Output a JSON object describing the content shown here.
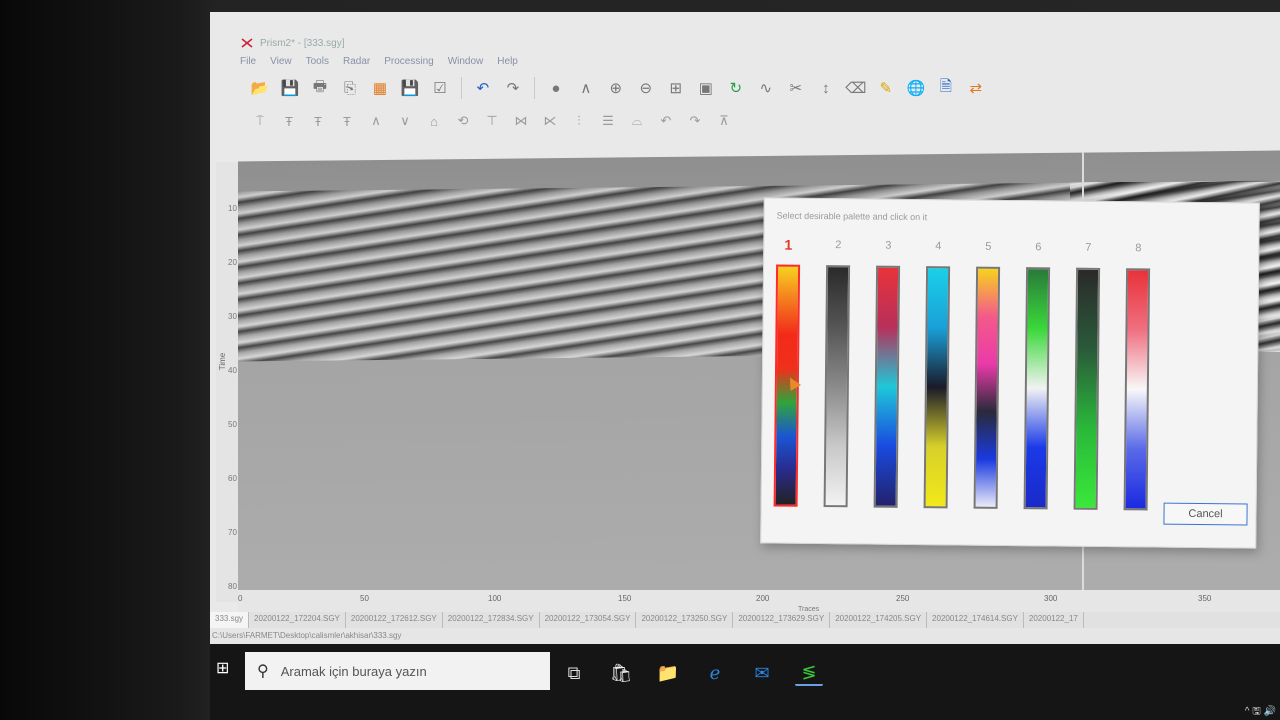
{
  "window": {
    "title": "Prism2* - [333.sgy]"
  },
  "menu": [
    "File",
    "View",
    "Tools",
    "Radar",
    "Processing",
    "Window",
    "Help"
  ],
  "toolbar": {
    "row1": [
      {
        "icon": "open-folder-icon",
        "glyph": "📂",
        "color": "yellow"
      },
      {
        "icon": "save-icon",
        "glyph": "💾",
        "color": "blue"
      },
      {
        "icon": "print-icon",
        "glyph": "🖶",
        "color": "grey"
      },
      {
        "icon": "export-icon",
        "glyph": "⎘",
        "color": "grey"
      },
      {
        "icon": "palette-grid-icon",
        "glyph": "▦",
        "color": "orange"
      },
      {
        "icon": "save-as-icon",
        "glyph": "💾",
        "color": "blue"
      },
      {
        "icon": "checkbox-icon",
        "glyph": "☑",
        "color": "grey"
      },
      {
        "icon": "undo-icon",
        "glyph": "↶",
        "color": "blue"
      },
      {
        "icon": "redo-icon",
        "glyph": "↷",
        "color": "grey"
      },
      {
        "icon": "point-icon",
        "glyph": "●",
        "color": "grey"
      },
      {
        "icon": "peak-icon",
        "glyph": "∧",
        "color": "grey"
      },
      {
        "icon": "zoom-in-icon",
        "glyph": "⊕",
        "color": "grey"
      },
      {
        "icon": "zoom-out-icon",
        "glyph": "⊖",
        "color": "grey"
      },
      {
        "icon": "fit-icon",
        "glyph": "⊞",
        "color": "grey"
      },
      {
        "icon": "image-icon",
        "glyph": "▣",
        "color": "grey"
      },
      {
        "icon": "refresh-icon",
        "glyph": "↻",
        "color": "green"
      },
      {
        "icon": "wave-icon",
        "glyph": "∿",
        "color": "grey"
      },
      {
        "icon": "cut-icon",
        "glyph": "✂",
        "color": "grey"
      },
      {
        "icon": "vertical-arrows-icon",
        "glyph": "↕",
        "color": "grey"
      },
      {
        "icon": "eraser-icon",
        "glyph": "⌫",
        "color": "grey"
      },
      {
        "icon": "pencil-icon",
        "glyph": "✎",
        "color": "yellow"
      },
      {
        "icon": "globe-icon",
        "glyph": "🌐",
        "color": "blue"
      },
      {
        "icon": "document-icon",
        "glyph": "🗎",
        "color": "blue"
      },
      {
        "icon": "transfer-icon",
        "glyph": "⇄",
        "color": "orange"
      }
    ],
    "row2": [
      {
        "icon": "marker-icon",
        "glyph": "⍑"
      },
      {
        "icon": "text-top-icon",
        "glyph": "Ŧ"
      },
      {
        "icon": "text-grid-icon",
        "glyph": "Ŧ"
      },
      {
        "icon": "text-icon",
        "glyph": "Ŧ"
      },
      {
        "icon": "caret-up-icon",
        "glyph": "∧"
      },
      {
        "icon": "caret-down-icon",
        "glyph": "∨"
      },
      {
        "icon": "home-icon",
        "glyph": "⌂"
      },
      {
        "icon": "rotate-icon",
        "glyph": "⟲"
      },
      {
        "icon": "align-top-icon",
        "glyph": "⊤"
      },
      {
        "icon": "pick-icon",
        "glyph": "⋈"
      },
      {
        "icon": "pick2-icon",
        "glyph": "⋉"
      },
      {
        "icon": "bars-icon",
        "glyph": "⫶"
      },
      {
        "icon": "level-icon",
        "glyph": "☰"
      },
      {
        "icon": "mound-icon",
        "glyph": "⌓"
      },
      {
        "icon": "undo-small-icon",
        "glyph": "↶"
      },
      {
        "icon": "redo-small-icon",
        "glyph": "↷"
      },
      {
        "icon": "gap-icon",
        "glyph": "⊼"
      }
    ]
  },
  "radar": {
    "y_ticks": [
      "10",
      "20",
      "30",
      "40",
      "50",
      "60",
      "70",
      "80"
    ],
    "y_label": "Time",
    "x_ticks": [
      "0",
      "50",
      "100",
      "150",
      "200",
      "250",
      "300",
      "350"
    ],
    "x_label": "Traces"
  },
  "file_tabs": [
    "333.sgy",
    "20200122_172204.SGY",
    "20200122_172612.SGY",
    "20200122_172834.SGY",
    "20200122_173054.SGY",
    "20200122_173250.SGY",
    "20200122_173629.SGY",
    "20200122_174205.SGY",
    "20200122_174614.SGY",
    "20200122_17"
  ],
  "status": {
    "path": "C:\\Users\\FARMET\\Desktop\\calismler\\akhisar\\333.sgy"
  },
  "dialog": {
    "title": "Select desirable palette and click on it",
    "selected": 1,
    "palettes": [
      {
        "num": "1",
        "stops": [
          "#f7d21e",
          "#f47a1e",
          "#f22a1a",
          "#f0301a",
          "#2fa43a",
          "#1a55d4",
          "#2a2a8a",
          "#222"
        ]
      },
      {
        "num": "2",
        "stops": [
          "#2a2a2a",
          "#555",
          "#8a8a8a",
          "#c8c8c8",
          "#f2f2f2"
        ]
      },
      {
        "num": "3",
        "stops": [
          "#e8323a",
          "#b8305a",
          "#1ec8d8",
          "#1a4ae0",
          "#22226a"
        ]
      },
      {
        "num": "4",
        "stops": [
          "#1ad0e8",
          "#1aa0d8",
          "#1a1a2a",
          "#d8d02a",
          "#f2e81a"
        ]
      },
      {
        "num": "5",
        "stops": [
          "#f7d21e",
          "#f45a8a",
          "#ea3aa8",
          "#2a2a3a",
          "#1a3ae0",
          "#eaeaf8"
        ]
      },
      {
        "num": "6",
        "stops": [
          "#2a7a3a",
          "#3ad83a",
          "#f2f2f2",
          "#1a3ae8",
          "#1a2ac8"
        ]
      },
      {
        "num": "7",
        "stops": [
          "#2a2a2a",
          "#2a5a3a",
          "#2ab83a",
          "#3ae83a"
        ]
      },
      {
        "num": "8",
        "stops": [
          "#e8323a",
          "#f07080",
          "#f8f8f8",
          "#5a6ae8",
          "#1a2ae0"
        ]
      }
    ],
    "cancel_label": "Cancel"
  },
  "taskbar": {
    "search_placeholder": "Aramak için buraya yazın",
    "icons": [
      {
        "name": "task-view-icon",
        "glyph": "⧉",
        "color": "#ddd"
      },
      {
        "name": "store-icon",
        "glyph": "🛍",
        "color": "#f2f2f2"
      },
      {
        "name": "file-explorer-icon",
        "glyph": "📁",
        "color": "#f2c12a"
      },
      {
        "name": "edge-icon",
        "glyph": "ℯ",
        "color": "#2a86e0"
      },
      {
        "name": "mail-icon",
        "glyph": "✉",
        "color": "#2a86e0"
      },
      {
        "name": "prism-app-icon",
        "glyph": "≶",
        "color": "#3ac83a"
      }
    ],
    "tray": "^ 🖫 🔊"
  }
}
